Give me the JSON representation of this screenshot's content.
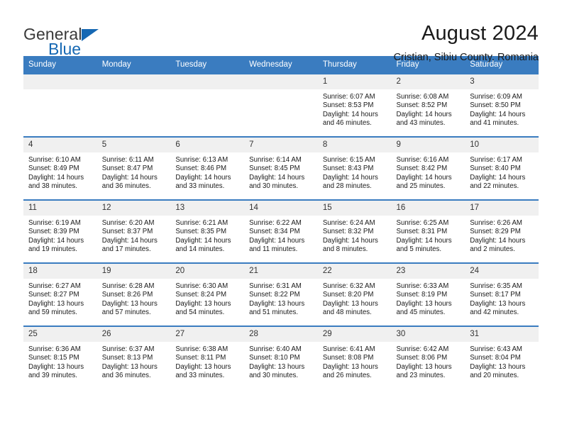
{
  "brand": {
    "name_part1": "General",
    "name_part2": "Blue",
    "triangle_color": "#1668b3"
  },
  "header": {
    "title": "August 2024",
    "subtitle": "Cristian, Sibiu County, Romania"
  },
  "theme": {
    "header_blue": "#3a7cc0",
    "day_band_gray": "#f0f0f0",
    "text_color": "#1a1a1a"
  },
  "weekday_headers": [
    "Sunday",
    "Monday",
    "Tuesday",
    "Wednesday",
    "Thursday",
    "Friday",
    "Saturday"
  ],
  "labels": {
    "sunrise_prefix": "Sunrise: ",
    "sunset_prefix": "Sunset: ",
    "daylight_prefix": "Daylight: "
  },
  "weeks": [
    [
      {
        "day": "",
        "empty": true
      },
      {
        "day": "",
        "empty": true
      },
      {
        "day": "",
        "empty": true
      },
      {
        "day": "",
        "empty": true
      },
      {
        "day": "1",
        "sunrise": "Sunrise: 6:07 AM",
        "sunset": "Sunset: 8:53 PM",
        "daylight_line1": "Daylight: 14 hours",
        "daylight_line2": "and 46 minutes."
      },
      {
        "day": "2",
        "sunrise": "Sunrise: 6:08 AM",
        "sunset": "Sunset: 8:52 PM",
        "daylight_line1": "Daylight: 14 hours",
        "daylight_line2": "and 43 minutes."
      },
      {
        "day": "3",
        "sunrise": "Sunrise: 6:09 AM",
        "sunset": "Sunset: 8:50 PM",
        "daylight_line1": "Daylight: 14 hours",
        "daylight_line2": "and 41 minutes."
      }
    ],
    [
      {
        "day": "4",
        "sunrise": "Sunrise: 6:10 AM",
        "sunset": "Sunset: 8:49 PM",
        "daylight_line1": "Daylight: 14 hours",
        "daylight_line2": "and 38 minutes."
      },
      {
        "day": "5",
        "sunrise": "Sunrise: 6:11 AM",
        "sunset": "Sunset: 8:47 PM",
        "daylight_line1": "Daylight: 14 hours",
        "daylight_line2": "and 36 minutes."
      },
      {
        "day": "6",
        "sunrise": "Sunrise: 6:13 AM",
        "sunset": "Sunset: 8:46 PM",
        "daylight_line1": "Daylight: 14 hours",
        "daylight_line2": "and 33 minutes."
      },
      {
        "day": "7",
        "sunrise": "Sunrise: 6:14 AM",
        "sunset": "Sunset: 8:45 PM",
        "daylight_line1": "Daylight: 14 hours",
        "daylight_line2": "and 30 minutes."
      },
      {
        "day": "8",
        "sunrise": "Sunrise: 6:15 AM",
        "sunset": "Sunset: 8:43 PM",
        "daylight_line1": "Daylight: 14 hours",
        "daylight_line2": "and 28 minutes."
      },
      {
        "day": "9",
        "sunrise": "Sunrise: 6:16 AM",
        "sunset": "Sunset: 8:42 PM",
        "daylight_line1": "Daylight: 14 hours",
        "daylight_line2": "and 25 minutes."
      },
      {
        "day": "10",
        "sunrise": "Sunrise: 6:17 AM",
        "sunset": "Sunset: 8:40 PM",
        "daylight_line1": "Daylight: 14 hours",
        "daylight_line2": "and 22 minutes."
      }
    ],
    [
      {
        "day": "11",
        "sunrise": "Sunrise: 6:19 AM",
        "sunset": "Sunset: 8:39 PM",
        "daylight_line1": "Daylight: 14 hours",
        "daylight_line2": "and 19 minutes."
      },
      {
        "day": "12",
        "sunrise": "Sunrise: 6:20 AM",
        "sunset": "Sunset: 8:37 PM",
        "daylight_line1": "Daylight: 14 hours",
        "daylight_line2": "and 17 minutes."
      },
      {
        "day": "13",
        "sunrise": "Sunrise: 6:21 AM",
        "sunset": "Sunset: 8:35 PM",
        "daylight_line1": "Daylight: 14 hours",
        "daylight_line2": "and 14 minutes."
      },
      {
        "day": "14",
        "sunrise": "Sunrise: 6:22 AM",
        "sunset": "Sunset: 8:34 PM",
        "daylight_line1": "Daylight: 14 hours",
        "daylight_line2": "and 11 minutes."
      },
      {
        "day": "15",
        "sunrise": "Sunrise: 6:24 AM",
        "sunset": "Sunset: 8:32 PM",
        "daylight_line1": "Daylight: 14 hours",
        "daylight_line2": "and 8 minutes."
      },
      {
        "day": "16",
        "sunrise": "Sunrise: 6:25 AM",
        "sunset": "Sunset: 8:31 PM",
        "daylight_line1": "Daylight: 14 hours",
        "daylight_line2": "and 5 minutes."
      },
      {
        "day": "17",
        "sunrise": "Sunrise: 6:26 AM",
        "sunset": "Sunset: 8:29 PM",
        "daylight_line1": "Daylight: 14 hours",
        "daylight_line2": "and 2 minutes."
      }
    ],
    [
      {
        "day": "18",
        "sunrise": "Sunrise: 6:27 AM",
        "sunset": "Sunset: 8:27 PM",
        "daylight_line1": "Daylight: 13 hours",
        "daylight_line2": "and 59 minutes."
      },
      {
        "day": "19",
        "sunrise": "Sunrise: 6:28 AM",
        "sunset": "Sunset: 8:26 PM",
        "daylight_line1": "Daylight: 13 hours",
        "daylight_line2": "and 57 minutes."
      },
      {
        "day": "20",
        "sunrise": "Sunrise: 6:30 AM",
        "sunset": "Sunset: 8:24 PM",
        "daylight_line1": "Daylight: 13 hours",
        "daylight_line2": "and 54 minutes."
      },
      {
        "day": "21",
        "sunrise": "Sunrise: 6:31 AM",
        "sunset": "Sunset: 8:22 PM",
        "daylight_line1": "Daylight: 13 hours",
        "daylight_line2": "and 51 minutes."
      },
      {
        "day": "22",
        "sunrise": "Sunrise: 6:32 AM",
        "sunset": "Sunset: 8:20 PM",
        "daylight_line1": "Daylight: 13 hours",
        "daylight_line2": "and 48 minutes."
      },
      {
        "day": "23",
        "sunrise": "Sunrise: 6:33 AM",
        "sunset": "Sunset: 8:19 PM",
        "daylight_line1": "Daylight: 13 hours",
        "daylight_line2": "and 45 minutes."
      },
      {
        "day": "24",
        "sunrise": "Sunrise: 6:35 AM",
        "sunset": "Sunset: 8:17 PM",
        "daylight_line1": "Daylight: 13 hours",
        "daylight_line2": "and 42 minutes."
      }
    ],
    [
      {
        "day": "25",
        "sunrise": "Sunrise: 6:36 AM",
        "sunset": "Sunset: 8:15 PM",
        "daylight_line1": "Daylight: 13 hours",
        "daylight_line2": "and 39 minutes."
      },
      {
        "day": "26",
        "sunrise": "Sunrise: 6:37 AM",
        "sunset": "Sunset: 8:13 PM",
        "daylight_line1": "Daylight: 13 hours",
        "daylight_line2": "and 36 minutes."
      },
      {
        "day": "27",
        "sunrise": "Sunrise: 6:38 AM",
        "sunset": "Sunset: 8:11 PM",
        "daylight_line1": "Daylight: 13 hours",
        "daylight_line2": "and 33 minutes."
      },
      {
        "day": "28",
        "sunrise": "Sunrise: 6:40 AM",
        "sunset": "Sunset: 8:10 PM",
        "daylight_line1": "Daylight: 13 hours",
        "daylight_line2": "and 30 minutes."
      },
      {
        "day": "29",
        "sunrise": "Sunrise: 6:41 AM",
        "sunset": "Sunset: 8:08 PM",
        "daylight_line1": "Daylight: 13 hours",
        "daylight_line2": "and 26 minutes."
      },
      {
        "day": "30",
        "sunrise": "Sunrise: 6:42 AM",
        "sunset": "Sunset: 8:06 PM",
        "daylight_line1": "Daylight: 13 hours",
        "daylight_line2": "and 23 minutes."
      },
      {
        "day": "31",
        "sunrise": "Sunrise: 6:43 AM",
        "sunset": "Sunset: 8:04 PM",
        "daylight_line1": "Daylight: 13 hours",
        "daylight_line2": "and 20 minutes."
      }
    ]
  ]
}
